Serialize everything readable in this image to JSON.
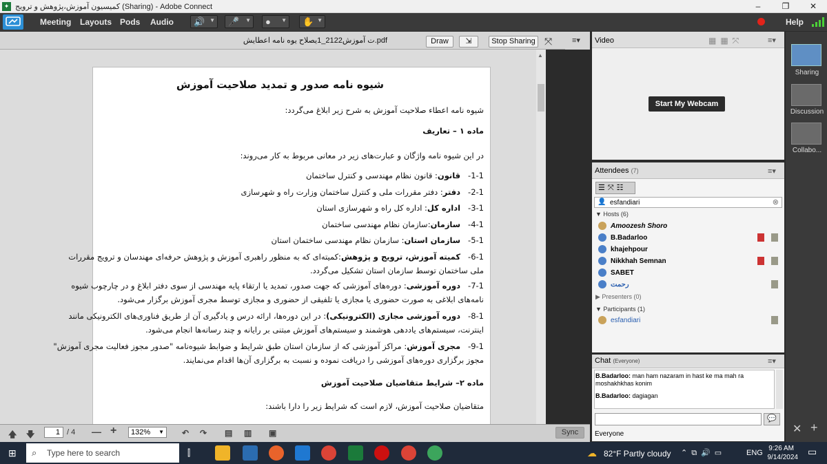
{
  "window": {
    "title": "کمیسیون آموزش،پژوهش و ترویج (Sharing) - Adobe Connect",
    "minimize": "–",
    "restore": "❐",
    "close": "✕"
  },
  "menu": {
    "items": [
      "Meeting",
      "Layouts",
      "Pods",
      "Audio"
    ],
    "help": "Help"
  },
  "share": {
    "filename": "pdf.ت آموزش2122_1یصلاح یوه نامه اعطایش",
    "draw": "Draw",
    "stop": "Stop Sharing"
  },
  "doc": {
    "title": "شیوه نامه صدور و تمدید صلاحیت  آموزش",
    "intro": "شیوه نامه اعطاء صلاحیت آموزش به شرح زیر ابلاغ می‌گردد:",
    "s1": "ماده ۱ – تعاریف",
    "s1intro": "در این شیوه نامه واژگان و عبارت‌های زیر در معانی مربوط به کار می‌روند:",
    "items": [
      {
        "n": "1-1-",
        "t": "قانون",
        "d": ": قانون نظام مهندسی و کنترل ساختمان"
      },
      {
        "n": "2-1-",
        "t": "دفتر",
        "d": ": دفتر مقررات ملی و کنترل ساختمان وزارت راه و شهرسازی"
      },
      {
        "n": "3-1-",
        "t": "اداره کل",
        "d": ": اداره کل راه و شهرسازی استان"
      },
      {
        "n": "4-1-",
        "t": "سازمان",
        "d": ":سازمان نظام مهندسی ساختمان"
      },
      {
        "n": "5-1-",
        "t": "سازمان استان",
        "d": ": سازمان نظام مهندسی ساختمان استان"
      },
      {
        "n": "6-1-",
        "t": "کمیته آموزش، ترویج و پژوهش",
        "d": ":کمیته‌ای که به منظور راهبری آموزش و پژوهش حرفه‌ای مهندسان و ترویج مقررات",
        "d2": "ملی ساختمان توسط سازمان استان تشکیل می‌گردد."
      },
      {
        "n": "7-1-",
        "t": "دوره آموزشی",
        "d": ": دوره‌های آموزشی که جهت صدور، تمدید یا ارتقاء پایه مهندسی از سوی دفتر ابلاغ و در چارچوب شیوه",
        "d2": "نامه‌های ابلاغی به صورت حضوری یا مجازی یا تلفیقی از حضوری و مجازی توسط مجری آموزش برگزار می‌شود."
      },
      {
        "n": "8-1-",
        "t": "دوره آموزشی مجازی (الکترونیکی)",
        "d": ": در این دوره‌ها، ارائه درس و یادگیری آن از طریق فناوری‌های الکترونیکی مانند",
        "d2": "اینترنت، سیستم‌های یاددهی هوشمند و سیستم‌های آموزش مبتنی بر رایانه و چند رسانه‌ها انجام می‌شود."
      },
      {
        "n": "9-1-",
        "t": "مجری آموزش",
        "d": ": مراکز آموزشی که از سازمان استان طبق شرایط و ضوابط شیوه‌نامه \"صدور مجوز فعالیت مجری آموزش\"",
        "d2": "مجوز برگزاری دوره‌های آموزشی را دریافت نموده و نسبت به برگزاری آن‌ها اقدام می‌نمایند."
      }
    ],
    "s2": "ماده ۲– شرایط متقاضیان صلاحیت آموزش",
    "s2intro": "متقاضیان صلاحیت آموزش، لازم است که شرایط زیر را دارا باشند:"
  },
  "pager": {
    "page": "1",
    "total": "/ 4",
    "zoom": "132%",
    "sync": "Sync"
  },
  "video": {
    "title": "Video",
    "webcam": "Start My Webcam"
  },
  "attendees": {
    "title": "Attendees",
    "count": "(7)",
    "search": "esfandiari",
    "hosts_label": "Hosts (6)",
    "hosts": [
      "Amoozesh Shoro",
      "B.Badarloo",
      "khajehpour",
      "Nikkhah Semnan",
      "SABET",
      "رحمت"
    ],
    "presenters_label": "Presenters (0)",
    "participants_label": "Participants (1)",
    "participants": [
      "esfandiari"
    ]
  },
  "chat": {
    "title": "Chat",
    "scope": "(Everyone)",
    "messages": [
      {
        "from": "B.Badarloo:",
        "text": "man ham nazaram in hast ke ma mah ra",
        "text2": "moshakhkhas konim"
      },
      {
        "from": "B.Badarloo:",
        "text": "dagiagan",
        "text2": ""
      }
    ],
    "target": "Everyone"
  },
  "layouts": [
    "Sharing",
    "Discussion",
    "Collabo..."
  ],
  "taskbar": {
    "search": "Type here to search",
    "weather": "82°F  Partly cloudy",
    "lang": "ENG",
    "time": "9:26 AM",
    "date": "9/14/2024"
  },
  "colors": {
    "accent": "#2c8fd6",
    "highlight": "#c00000"
  }
}
